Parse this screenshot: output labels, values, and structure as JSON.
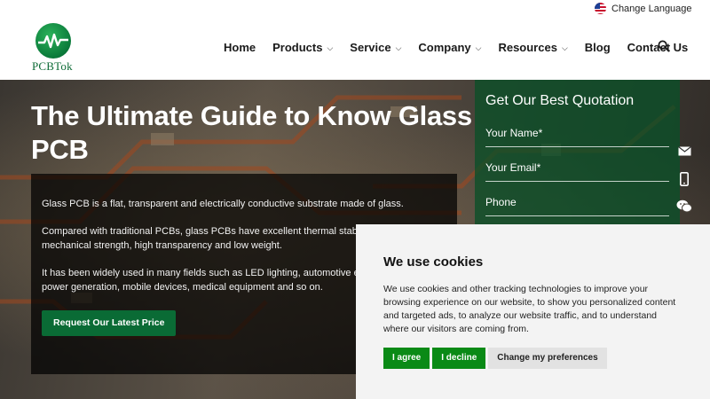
{
  "header": {
    "language_label": "Change Language",
    "logo_text": "PCBTok",
    "nav": [
      {
        "label": "Home",
        "dropdown": false
      },
      {
        "label": "Products",
        "dropdown": true
      },
      {
        "label": "Service",
        "dropdown": true
      },
      {
        "label": "Company",
        "dropdown": true
      },
      {
        "label": "Resources",
        "dropdown": true
      },
      {
        "label": "Blog",
        "dropdown": false
      },
      {
        "label": "Contact Us",
        "dropdown": false
      }
    ],
    "chevron": "⌵",
    "search_icon": "search-icon"
  },
  "hero": {
    "title": "The Ultimate Guide to Know Glass PCB",
    "paragraphs": [
      "Glass PCB is a flat, transparent and electrically conductive substrate made of glass.",
      "Compared with traditional PCBs, glass PCBs have excellent thermal stability, high mechanical strength, high transparency and low weight.",
      "It has been widely used in many fields such as LED lighting, automotive electronics, solar power generation, mobile devices, medical equipment and so on."
    ],
    "cta_label": "Request Our Latest Price"
  },
  "quote": {
    "title": "Get Our Best Quotation",
    "fields": [
      "Your Name*",
      "Your Email*",
      "Phone"
    ]
  },
  "side_icons": [
    "email-icon",
    "phone-icon",
    "wechat-icon"
  ],
  "cookie": {
    "title": "We use cookies",
    "text": "We use cookies and other tracking technologies to improve your browsing experience on our website, to show you personalized content and targeted ads, to analyze our website traffic, and to understand where our visitors are coming from.",
    "agree_label": "I agree",
    "decline_label": "I decline",
    "preferences_label": "Change my preferences"
  },
  "colors": {
    "brand_green": "#0a6b35",
    "cookie_button_green": "#0a8a16"
  }
}
